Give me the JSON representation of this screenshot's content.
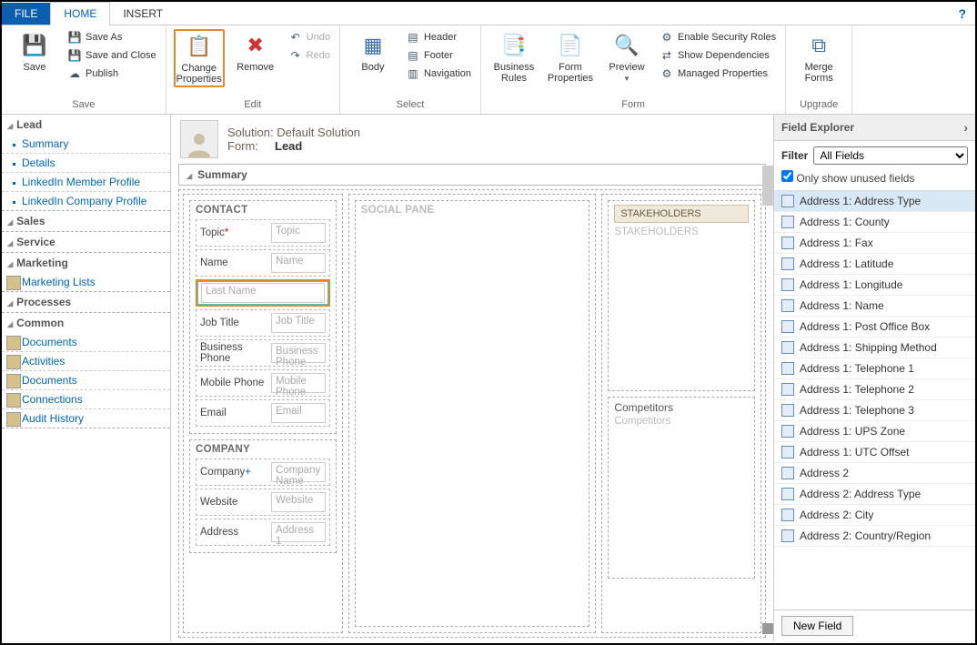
{
  "tabs": {
    "file": "FILE",
    "home": "HOME",
    "insert": "INSERT"
  },
  "ribbon": {
    "save": {
      "big": "Save",
      "saveas": "Save As",
      "saveclose": "Save and Close",
      "publish": "Publish",
      "group": "Save"
    },
    "edit": {
      "changeprops": "Change Properties",
      "remove": "Remove",
      "undo": "Undo",
      "redo": "Redo",
      "group": "Edit"
    },
    "select": {
      "body": "Body",
      "header": "Header",
      "footer": "Footer",
      "navigation": "Navigation",
      "group": "Select"
    },
    "form": {
      "bizrules": "Business Rules",
      "formprops": "Form Properties",
      "preview": "Preview",
      "security": "Enable Security Roles",
      "deps": "Show Dependencies",
      "managed": "Managed Properties",
      "group": "Form"
    },
    "upgrade": {
      "merge": "Merge Forms",
      "group": "Upgrade"
    }
  },
  "leftnav": {
    "lead": {
      "title": "Lead",
      "items": [
        "Summary",
        "Details",
        "LinkedIn Member Profile",
        "LinkedIn Company Profile"
      ]
    },
    "sales": "Sales",
    "service": "Service",
    "marketing": {
      "title": "Marketing",
      "items": [
        "Marketing Lists"
      ]
    },
    "processes": "Processes",
    "common": {
      "title": "Common",
      "items": [
        "Documents",
        "Activities",
        "Documents",
        "Connections",
        "Audit History"
      ]
    }
  },
  "canvas": {
    "sol_label": "Solution:",
    "sol_value": "Default Solution",
    "form_label": "Form:",
    "form_value": "Lead",
    "summary": "Summary",
    "contact": {
      "title": "CONTACT",
      "topic_l": "Topic",
      "topic_p": "Topic",
      "name_l": "Name",
      "name_p": "Name",
      "lastname_p": "Last Name",
      "jobtitle_l": "Job Title",
      "jobtitle_p": "Job Title",
      "bphone_l": "Business Phone",
      "bphone_p": "Business Phone",
      "mphone_l": "Mobile Phone",
      "mphone_p": "Mobile Phone",
      "email_l": "Email",
      "email_p": "Email"
    },
    "company": {
      "title": "COMPANY",
      "company_l": "Company",
      "company_p": "Company Name",
      "website_l": "Website",
      "website_p": "Website",
      "address_l": "Address",
      "address_p": "Address 1"
    },
    "social": "SOCIAL PANE",
    "stakeholders": {
      "title": "STAKEHOLDERS",
      "ph": "STAKEHOLDERS"
    },
    "competitors": {
      "title": "Competitors",
      "ph": "Competitors"
    }
  },
  "fieldexp": {
    "title": "Field Explorer",
    "filter_l": "Filter",
    "filter_v": "All Fields",
    "chk": "Only show unused fields",
    "items": [
      "Address 1: Address Type",
      "Address 1: County",
      "Address 1: Fax",
      "Address 1: Latitude",
      "Address 1: Longitude",
      "Address 1: Name",
      "Address 1: Post Office Box",
      "Address 1: Shipping Method",
      "Address 1: Telephone 1",
      "Address 1: Telephone 2",
      "Address 1: Telephone 3",
      "Address 1: UPS Zone",
      "Address 1: UTC Offset",
      "Address 2",
      "Address 2: Address Type",
      "Address 2: City",
      "Address 2: Country/Region"
    ],
    "newfield": "New Field"
  }
}
